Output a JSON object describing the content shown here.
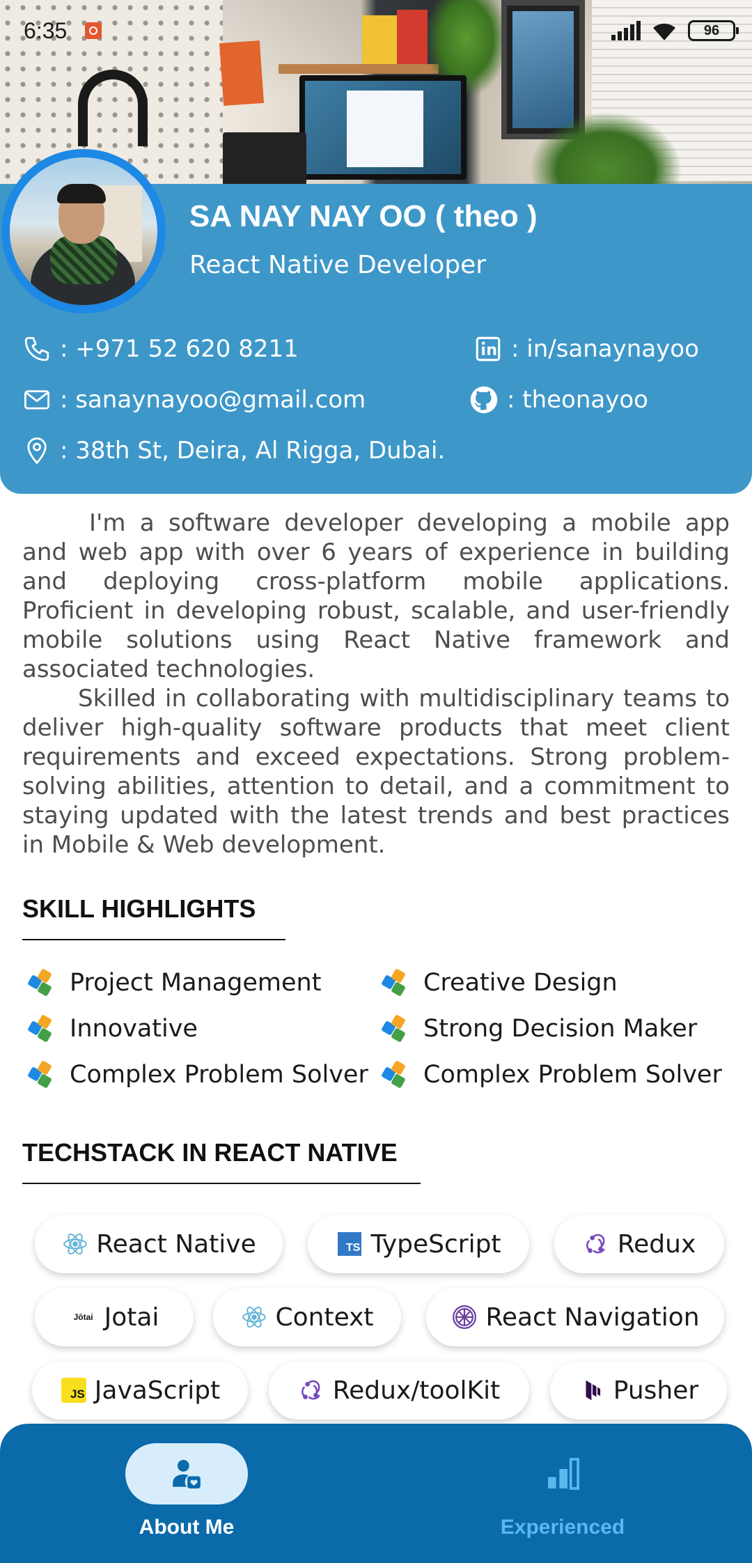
{
  "status_bar": {
    "time": "6:35",
    "battery": "96"
  },
  "profile": {
    "name": "SA NAY NAY OO ( theo )",
    "role": "React Native Developer",
    "phone": ": +971 52 620 8211",
    "email": ": sanaynayoo@gmail.com",
    "address": ": 38th St, Deira, Al Rigga, Dubai.",
    "linkedin": ": in/sanaynayoo",
    "github": ": theonayoo"
  },
  "about": {
    "paragraph1": "I'm a software developer developing a mobile app and web app with over 6 years of experience in building and deploying cross-platform mobile applications. Proficient in developing robust, scalable, and user-friendly mobile solutions using React Native framework and associated technologies.",
    "paragraph2": "Skilled in collaborating with multidisciplinary teams to deliver high-quality software products that meet client requirements and exceed expectations. Strong problem-solving abilities, attention to detail, and a commitment to staying updated with the latest trends and best practices in Mobile & Web development."
  },
  "skills": {
    "title": "SKILL HIGHLIGHTS",
    "items": [
      "Project Management",
      "Creative Design",
      "Innovative",
      "Strong Decision Maker",
      "Complex Problem Solver",
      "Complex Problem Solver"
    ]
  },
  "techstack": {
    "title": "TECHSTACK IN REACT NATIVE",
    "items": [
      {
        "label": "React Native",
        "icon": "react-icon"
      },
      {
        "label": "TypeScript",
        "icon": "typescript-icon",
        "badge": "TS"
      },
      {
        "label": "Redux",
        "icon": "redux-icon"
      },
      {
        "label": "Jotai",
        "icon": "jotai-icon",
        "badge": "Jōtai"
      },
      {
        "label": "Context",
        "icon": "react-icon"
      },
      {
        "label": "React Navigation",
        "icon": "react-navigation-icon"
      },
      {
        "label": "JavaScript",
        "icon": "javascript-icon",
        "badge": "JS"
      },
      {
        "label": "Redux/toolKit",
        "icon": "redux-icon"
      },
      {
        "label": "Pusher",
        "icon": "pusher-icon"
      }
    ]
  },
  "bottom_nav": {
    "items": [
      {
        "label": "About Me",
        "icon": "user-badge-icon",
        "active": true
      },
      {
        "label": "Experienced",
        "icon": "bar-chart-icon",
        "active": false
      }
    ]
  },
  "colors": {
    "card": "#3e97c9",
    "nav": "#0a6aaa",
    "nav_active_pill": "#d7edfb",
    "nav_inactive_label": "#59b8ef",
    "avatar_ring": "#1e88e5"
  }
}
